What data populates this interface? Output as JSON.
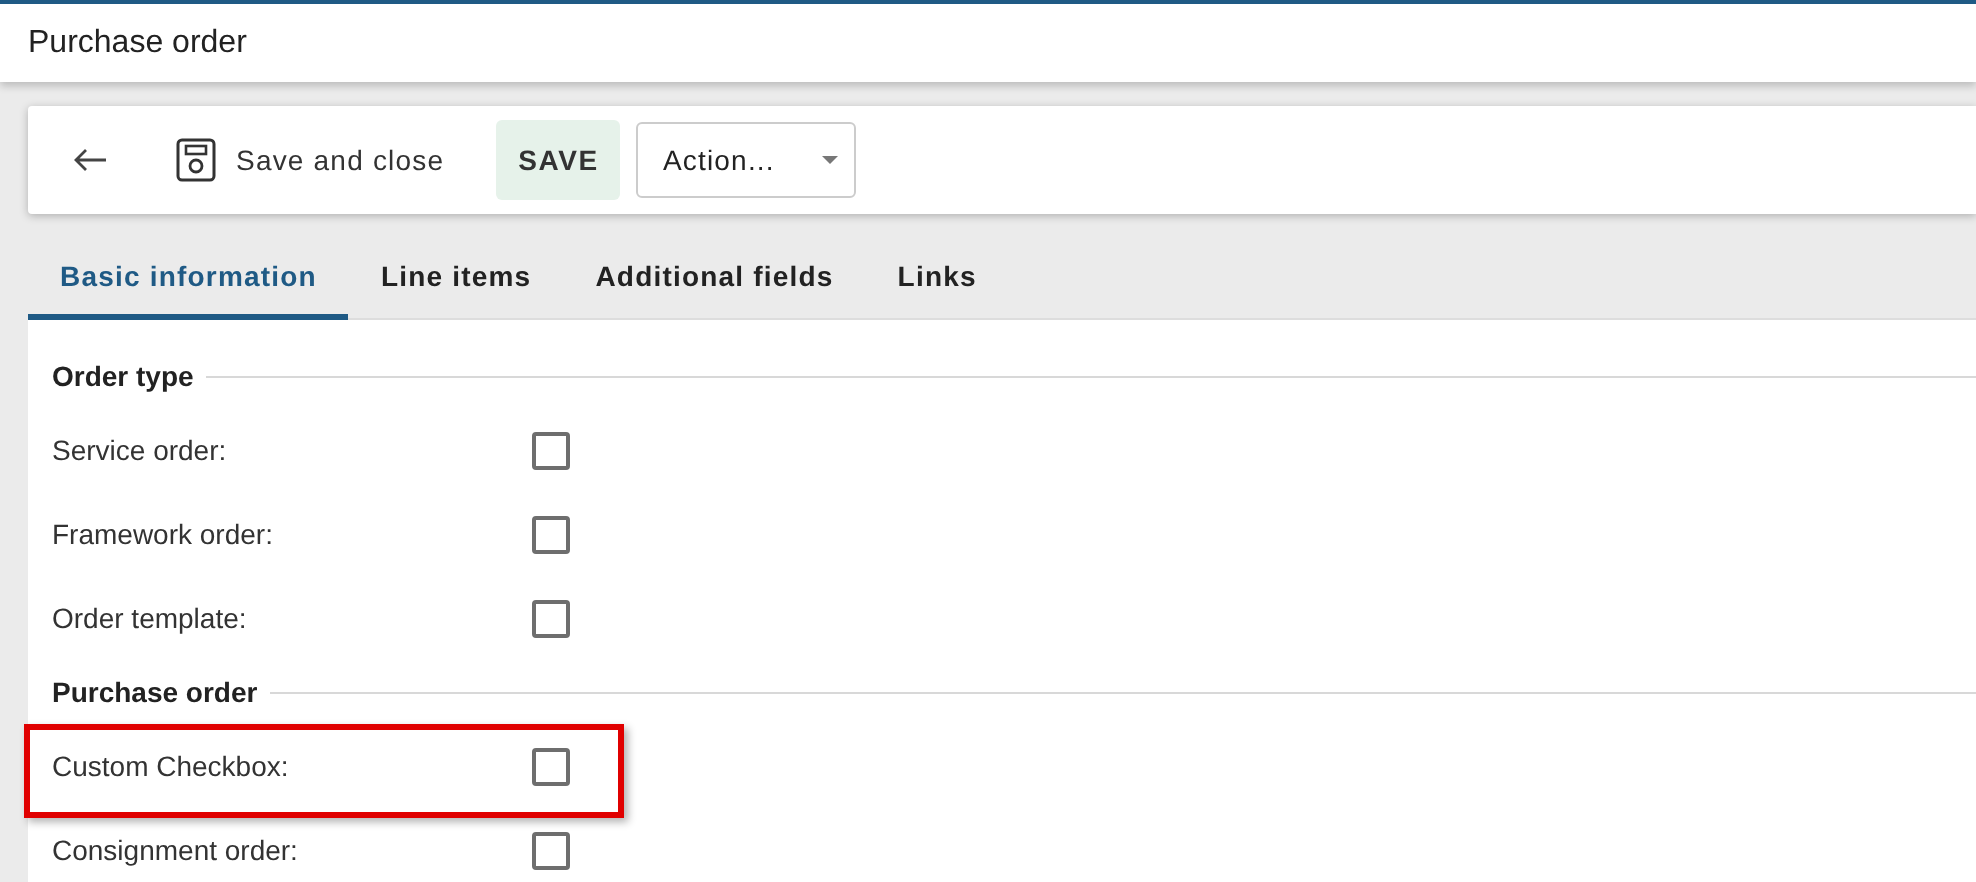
{
  "header": {
    "title": "Purchase order"
  },
  "toolbar": {
    "save_and_close": "Save and close",
    "save": "SAVE",
    "action": {
      "value": "Action..."
    }
  },
  "tabs": [
    {
      "label": "Basic information",
      "selected": true
    },
    {
      "label": "Line items",
      "selected": false
    },
    {
      "label": "Additional fields",
      "selected": false
    },
    {
      "label": "Links",
      "selected": false
    }
  ],
  "sections": [
    {
      "title": "Order type",
      "fields": [
        {
          "label": "Service order:",
          "checked": false,
          "highlighted": false
        },
        {
          "label": "Framework order:",
          "checked": false,
          "highlighted": false
        },
        {
          "label": "Order template:",
          "checked": false,
          "highlighted": false
        }
      ]
    },
    {
      "title": "Purchase order",
      "fields": [
        {
          "label": "Custom Checkbox:",
          "checked": false,
          "highlighted": true
        },
        {
          "label": "Consignment order:",
          "checked": false,
          "highlighted": false
        }
      ]
    }
  ]
}
